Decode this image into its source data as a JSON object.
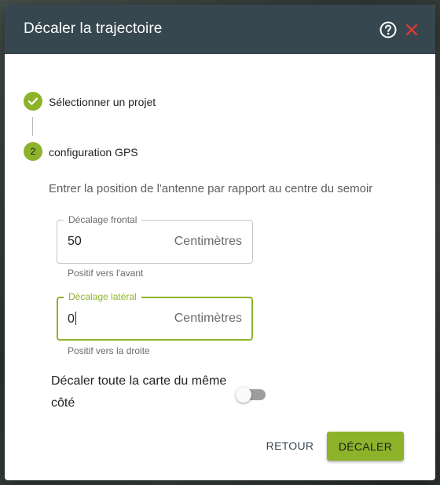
{
  "dialog": {
    "title": "Décaler la trajectoire",
    "help_icon": "help-circle-icon",
    "close_icon": "close-x-icon"
  },
  "stepper": {
    "steps": [
      {
        "label": "Sélectionner un projet",
        "state": "completed",
        "icon": "check-icon"
      },
      {
        "label": "configuration GPS",
        "state": "active",
        "number": "2"
      }
    ]
  },
  "form": {
    "intro": "Entrer la position de l'antenne par rapport au centre du semoir",
    "fields": [
      {
        "label": "Décalage frontal",
        "value": "50",
        "unit": "Centimètres",
        "helper": "Positif vers l'avant",
        "focused": false
      },
      {
        "label": "Décalage latéral",
        "value": "0",
        "unit": "Centimètres",
        "helper": "Positif vers la droite",
        "focused": true
      }
    ],
    "toggle": {
      "label": "Décaler toute la carte du même côté",
      "on": false
    }
  },
  "actions": {
    "back_label": "RETOUR",
    "submit_label": "DÉCALER"
  },
  "colors": {
    "accent": "#8db32b",
    "header_bg": "#37474f",
    "close_red": "#e53935"
  }
}
